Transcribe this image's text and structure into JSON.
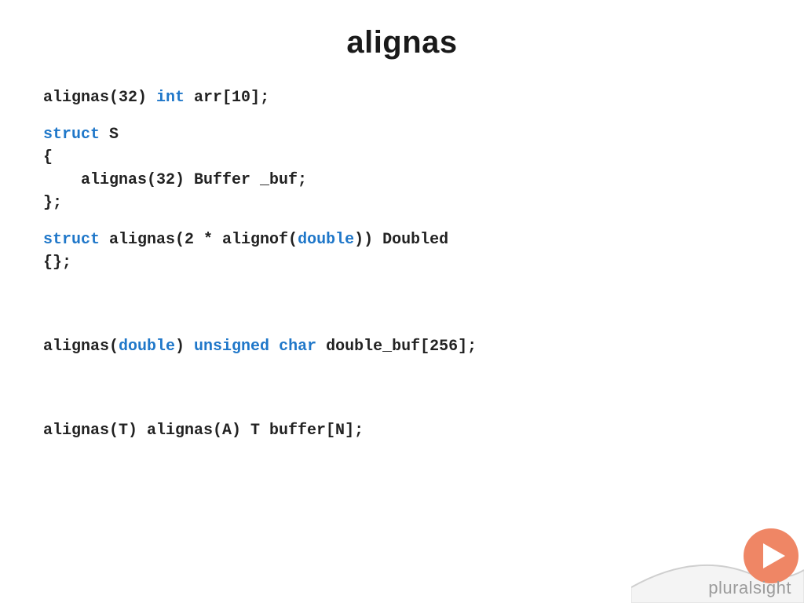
{
  "title": "alignas",
  "code": {
    "line1_a": "alignas(32) ",
    "line1_kw": "int",
    "line1_b": " arr[10];",
    "block2_l1_kw": "struct",
    "block2_l1_b": " S",
    "block2_l2": "{",
    "block2_l3": "    alignas(32) Buffer _buf;",
    "block2_l4": "};",
    "block3_l1_kw": "struct",
    "block3_l1_b": " alignas(2 * alignof(",
    "block3_l1_kw2": "double",
    "block3_l1_c": ")) Doubled",
    "block3_l2": "{};",
    "line4_a": "alignas(",
    "line4_kw1": "double",
    "line4_b": ") ",
    "line4_kw2": "unsigned",
    "line4_c": " ",
    "line4_kw3": "char",
    "line4_d": " double_buf[256];",
    "line5": "alignas(T) alignas(A) T buffer[N];"
  },
  "brand": "pluralsight",
  "colors": {
    "keyword": "#1f77c9",
    "brand_orange": "#ef8665",
    "brand_grey": "#d9d9d9"
  }
}
